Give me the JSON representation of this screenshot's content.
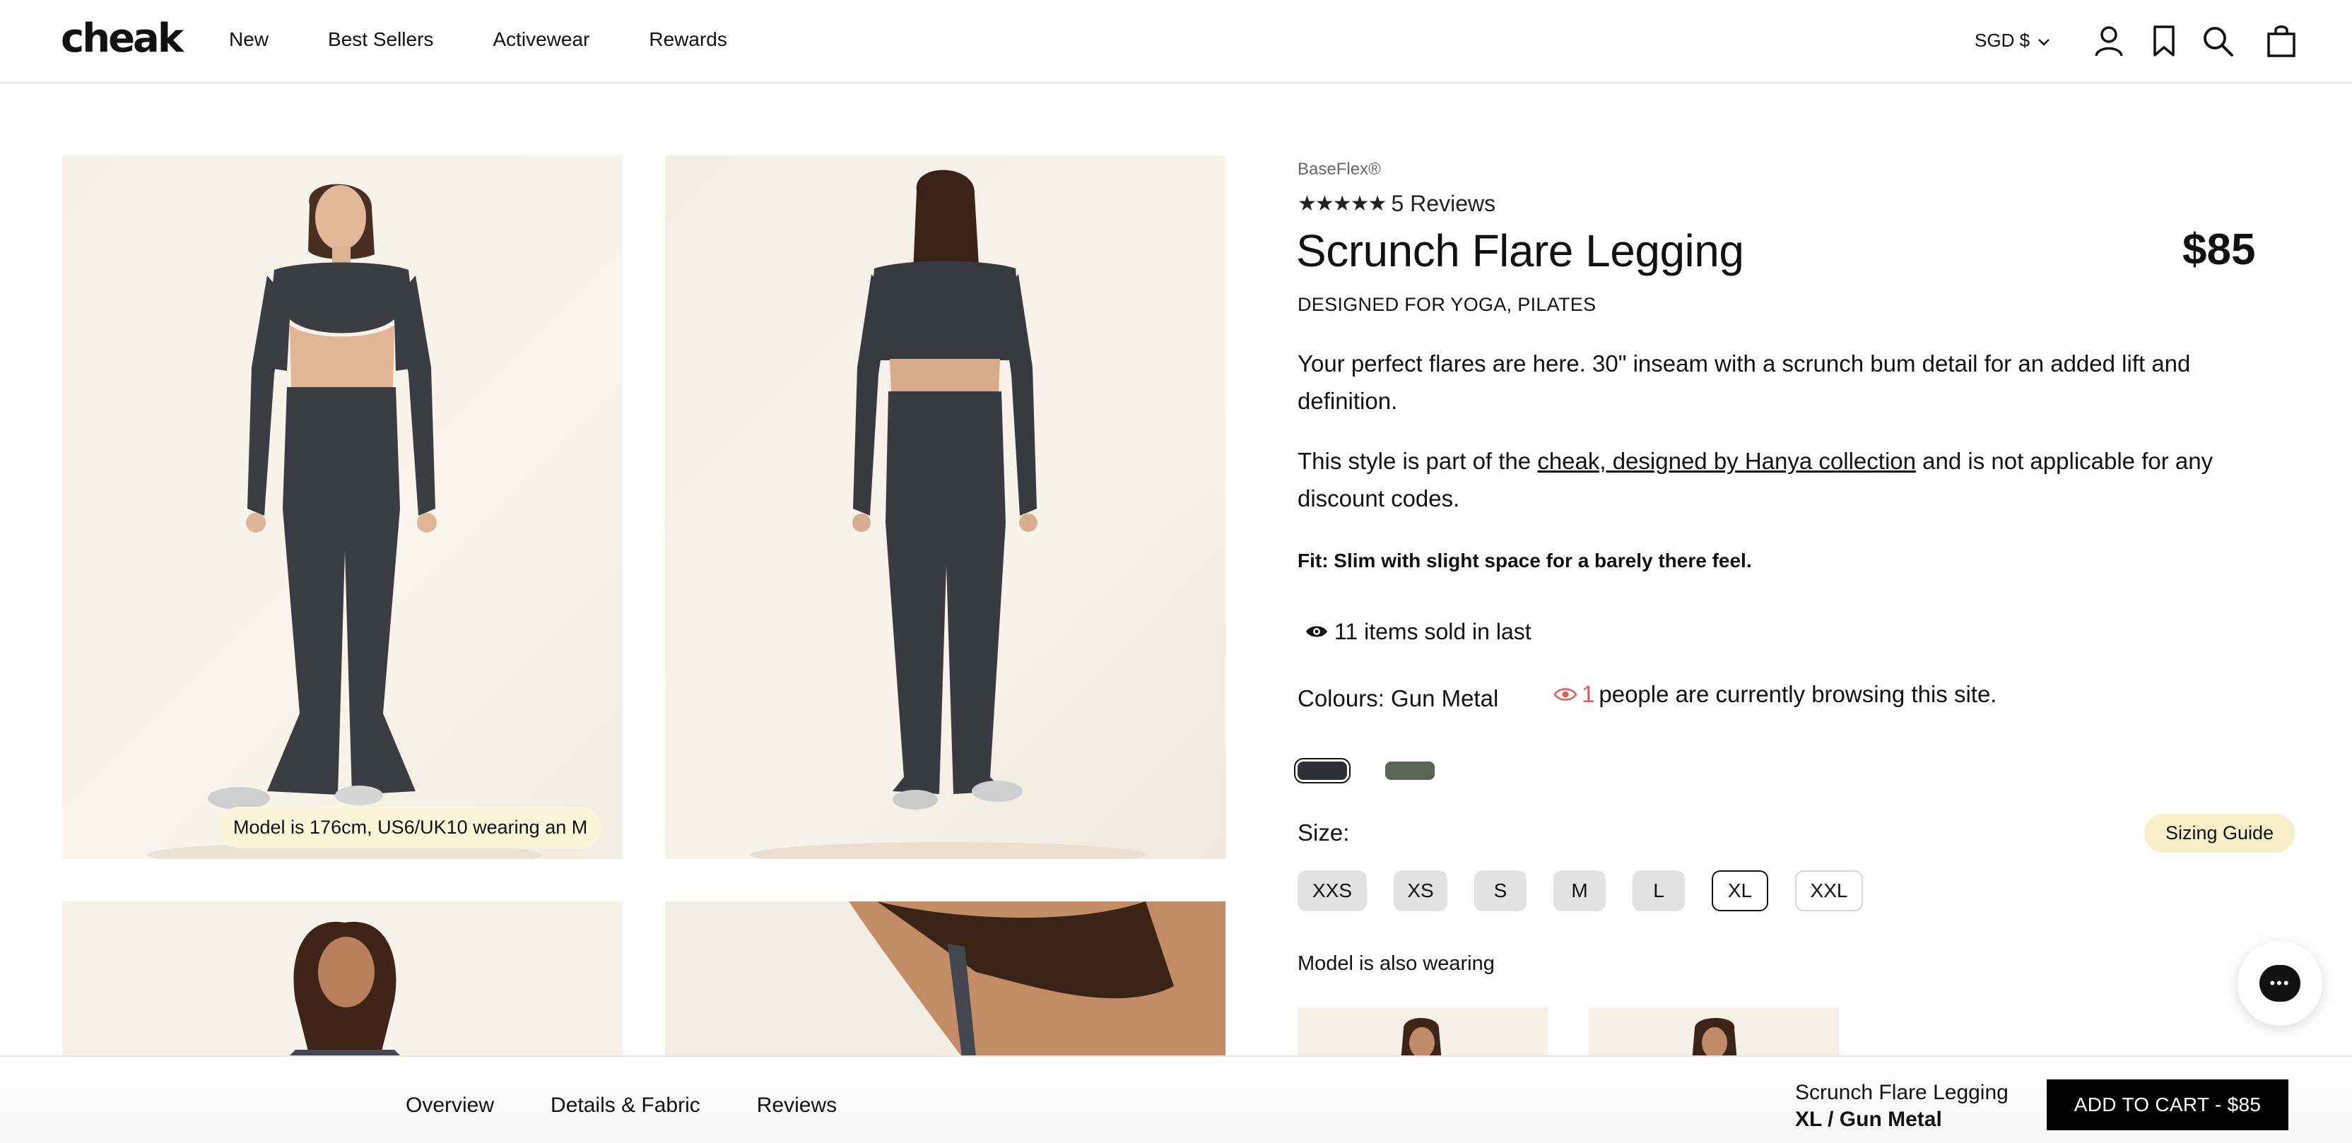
{
  "header": {
    "logo": "cheak",
    "nav": [
      "New",
      "Best Sellers",
      "Activewear",
      "Rewards"
    ],
    "currency": "SGD $",
    "icons": [
      "account-icon",
      "bookmark-icon",
      "search-icon",
      "bag-icon"
    ]
  },
  "gallery": {
    "caption": "Model is 176cm, US6/UK10 wearing an M"
  },
  "product": {
    "brand": "BaseFlex®",
    "stars": "★★★★★",
    "reviews": "5 Reviews",
    "title": "Scrunch Flare Legging",
    "price": "$85",
    "designed_for": "DESIGNED FOR YOGA, PILATES",
    "description": "Your perfect flares are here. 30\" inseam with a scrunch bum detail for an added lift and definition.",
    "collection_prefix": "This style is part of the ",
    "collection_link": "cheak, designed by Hanya collection",
    "collection_suffix": " and is not applicable for any discount codes.",
    "fit": "Fit: Slim with slight space for a barely there feel.",
    "sold": "11 items sold in last",
    "colours_label": "Colours: Gun Metal",
    "browsing_count": "1",
    "browsing_text": "people are currently browsing this site.",
    "swatches": [
      {
        "name": "Gun Metal",
        "color": "#2e3035"
      },
      {
        "name": "Olive",
        "color": "#5d6356"
      }
    ],
    "size_label": "Size:",
    "sizing_guide": "Sizing Guide",
    "sizes": [
      {
        "label": "XXS",
        "state": "available"
      },
      {
        "label": "XS",
        "state": "available"
      },
      {
        "label": "S",
        "state": "available"
      },
      {
        "label": "M",
        "state": "available"
      },
      {
        "label": "L",
        "state": "available"
      },
      {
        "label": "XL",
        "state": "selected"
      },
      {
        "label": "XXL",
        "state": "outline"
      }
    ],
    "also_wearing": "Model is also wearing"
  },
  "sticky": {
    "tabs": [
      "Overview",
      "Details & Fabric",
      "Reviews"
    ],
    "product_name": "Scrunch Flare Legging",
    "variant": "XL / Gun Metal",
    "add_to_cart": "ADD TO CART - $85"
  }
}
